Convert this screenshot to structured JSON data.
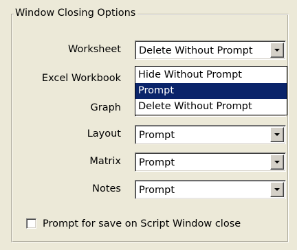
{
  "group": {
    "title": "Window Closing Options"
  },
  "rows": [
    {
      "label": "Worksheet",
      "value": "Delete Without Prompt"
    },
    {
      "label": "Excel Workbook",
      "value": ""
    },
    {
      "label": "Graph",
      "value": ""
    },
    {
      "label": "Layout",
      "value": "Prompt"
    },
    {
      "label": "Matrix",
      "value": "Prompt"
    },
    {
      "label": "Notes",
      "value": "Prompt"
    }
  ],
  "dropdown": {
    "options": [
      "Hide Without Prompt",
      "Prompt",
      "Delete Without Prompt"
    ],
    "highlighted": "Prompt"
  },
  "checkbox": {
    "label": "Prompt for save on Script Window close",
    "checked": false
  }
}
